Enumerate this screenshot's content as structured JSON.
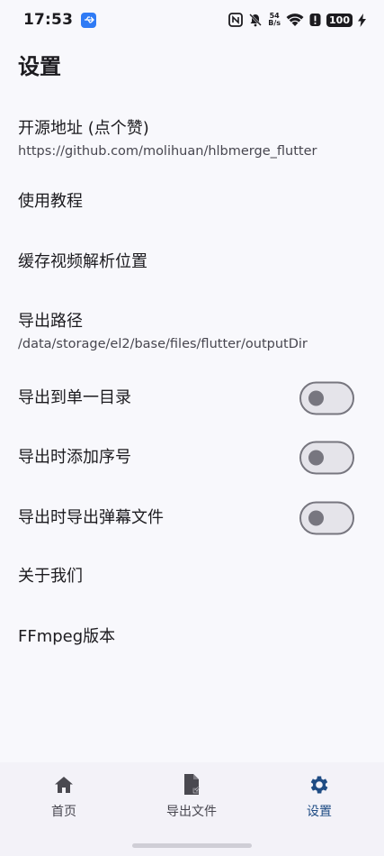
{
  "status_bar": {
    "time": "17:53",
    "net_speed_value": "54",
    "net_speed_unit": "B/s",
    "battery": "100",
    "icons": [
      "usb-icon",
      "nfc-icon",
      "mute-bell-icon",
      "wifi-icon",
      "alert-icon",
      "charging-icon"
    ]
  },
  "page": {
    "title": "设置"
  },
  "settings": [
    {
      "title": "开源地址 (点个赞)",
      "subtitle": "https://github.com/molihuan/hlbmerge_flutter"
    },
    {
      "title": "使用教程"
    },
    {
      "title": "缓存视频解析位置"
    },
    {
      "title": "导出路径",
      "subtitle": "/data/storage/el2/base/files/flutter/outputDir"
    },
    {
      "title": "导出到单一目录",
      "switch_on": false
    },
    {
      "title": "导出时添加序号",
      "switch_on": false
    },
    {
      "title": "导出时导出弹幕文件",
      "switch_on": false
    },
    {
      "title": "关于我们"
    },
    {
      "title": "FFmpeg版本"
    }
  ],
  "bottom_nav": {
    "active": "settings",
    "items": [
      {
        "label": "首页",
        "icon": "home-icon"
      },
      {
        "label": "导出文件",
        "icon": "file-export-icon"
      },
      {
        "label": "设置",
        "icon": "gear-icon"
      }
    ]
  },
  "colors": {
    "background": "#f8f8fc",
    "nav_background": "#f3f2f8",
    "nav_active": "#1f4c84",
    "switch_track": "#e5e4ea",
    "switch_outline": "#77767f"
  }
}
